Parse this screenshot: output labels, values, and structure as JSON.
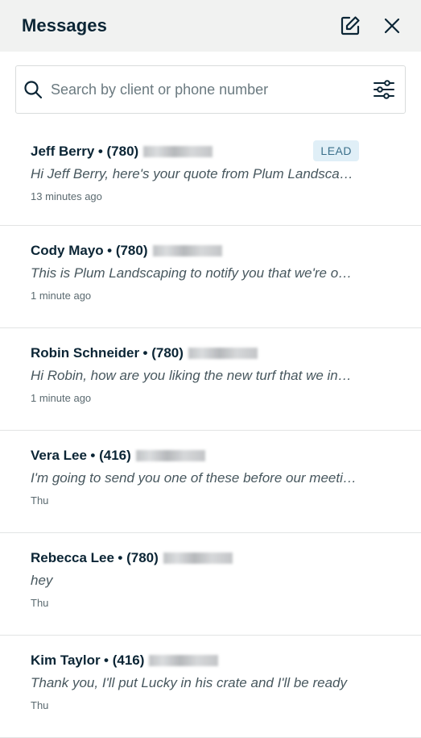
{
  "header": {
    "title": "Messages"
  },
  "search": {
    "placeholder": "Search by client or phone number"
  },
  "conversations": [
    {
      "name": "Jeff Berry",
      "area_code": "• (780)",
      "preview": "Hi Jeff Berry, here's your quote from Plum Landscaping",
      "time": "13 minutes ago",
      "badge": "LEAD"
    },
    {
      "name": "Cody Mayo",
      "area_code": "• (780)",
      "preview": "This is Plum Landscaping to notify you that we're on our way",
      "time": "1 minute ago"
    },
    {
      "name": "Robin Schneider",
      "area_code": "• (780)",
      "preview": "Hi Robin, how are you liking the new turf that we installed",
      "time": "1 minute ago"
    },
    {
      "name": "Vera Lee",
      "area_code": "• (416)",
      "preview": "I'm going to send you one of these before our meeting",
      "time": "Thu"
    },
    {
      "name": "Rebecca Lee",
      "area_code": "• (780)",
      "preview": "hey",
      "time": "Thu"
    },
    {
      "name": "Kim Taylor",
      "area_code": "• (416)",
      "preview": "Thank you, I'll put Lucky in his crate and I'll be ready",
      "time": "Thu"
    }
  ],
  "colors": {
    "header_bg": "#f1f2f1",
    "title": "#0b2535",
    "badge_bg": "#e0eff7",
    "badge_text": "#3a6f8a"
  },
  "icons": {
    "compose": "compose-icon",
    "close": "close-icon",
    "search": "search-icon",
    "filter": "filter-sliders-icon"
  }
}
